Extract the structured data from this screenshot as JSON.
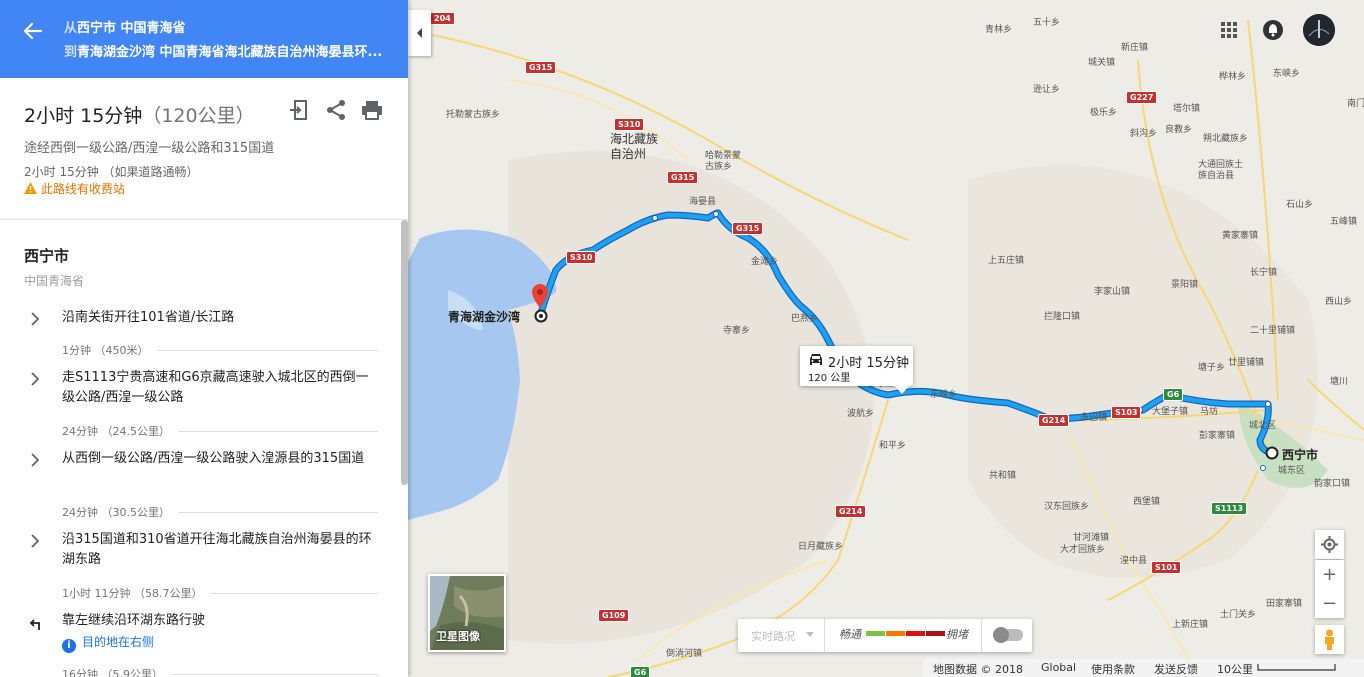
{
  "header": {
    "from_prefix": "从",
    "from_place": "西宁市 中国青海省",
    "to_prefix": "到",
    "to_place": "青海湖金沙湾 中国青海省海北藏族自治州海晏县环..."
  },
  "summary": {
    "time": "2小时 15分钟",
    "distance": "（120公里）",
    "via": "途经西倒一级公路/西湟一级公路和315国道",
    "traffic": "2小时 15分钟 （如果道路通畅）",
    "toll": "此路线有收费站"
  },
  "origin": {
    "title": "西宁市",
    "subtitle": "中国青海省"
  },
  "steps": [
    {
      "text": "沿南关街开往101省道/长江路",
      "dist": "1分钟 （450米）"
    },
    {
      "text": "走S1113宁贵高速和G6京藏高速驶入城北区的西倒一级公路/西湟一级公路",
      "dist": "24分钟 （24.5公里）"
    },
    {
      "text": "从西倒一级公路/西湟一级公路驶入湟源县的315国道",
      "dist": "24分钟 （30.5公里）"
    },
    {
      "text": "沿315国道和310省道开往海北藏族自治州海晏县的环湖东路",
      "dist": "1小时 11分钟 （58.7公里）"
    },
    {
      "text": "靠左继续沿环湖东路行驶",
      "note": "目的地在右侧",
      "dist": "16分钟 （5.9公里）"
    }
  ],
  "map": {
    "route_box": {
      "time": "2小时 15分钟",
      "distance": "120 公里"
    },
    "dest_label": "青海湖金沙湾",
    "origin_label": "西宁市",
    "satellite_label": "卫星图像",
    "traffic": {
      "live": "实时路况",
      "fast": "畅通",
      "slow": "拥堵",
      "colors": [
        "#7fc241",
        "#f57c00",
        "#e01010",
        "#a31515"
      ]
    },
    "footer": {
      "data": "地图数据 © 2018",
      "global": "Global",
      "terms": "使用条款",
      "feedback": "发送反馈",
      "scale": "10公里"
    },
    "route_color": "#1da1f2",
    "labels": [
      {
        "t": "青林乡"
      },
      {
        "t": "五十乡"
      },
      {
        "t": "城关镇"
      },
      {
        "t": "新庄镇"
      },
      {
        "t": "东峡乡"
      },
      {
        "t": "朔北藏族乡"
      },
      {
        "t": "大通回族土族自治县"
      },
      {
        "t": "良教乡"
      },
      {
        "t": "斜沟乡"
      },
      {
        "t": "极乐乡"
      },
      {
        "t": "逊让乡"
      },
      {
        "t": "塔尔镇"
      },
      {
        "t": "托勒蒙古族乡"
      },
      {
        "t": "哈勒景蒙古族乡"
      },
      {
        "t": "海晏县"
      },
      {
        "t": "海北藏族自治州"
      },
      {
        "t": "金滩乡"
      },
      {
        "t": "巴燕乡"
      },
      {
        "t": "寺寨乡"
      },
      {
        "t": "日月山"
      },
      {
        "t": "东峡乡"
      },
      {
        "t": "波航乡"
      },
      {
        "t": "和平乡"
      },
      {
        "t": "日月藏族乡"
      },
      {
        "t": "倒淌河镇"
      },
      {
        "t": "共和镇"
      },
      {
        "t": "汉东回族乡"
      },
      {
        "t": "甘河滩镇"
      },
      {
        "t": "大才回族乡"
      },
      {
        "t": "湟中县"
      },
      {
        "t": "多巴镇"
      },
      {
        "t": "大堡子镇"
      },
      {
        "t": "马坊"
      },
      {
        "t": "彭家寨镇"
      },
      {
        "t": "城北区"
      },
      {
        "t": "城东区"
      },
      {
        "t": "韵家口镇"
      },
      {
        "t": "西堡镇"
      },
      {
        "t": "上五庄镇"
      },
      {
        "t": "李家山镇"
      },
      {
        "t": "拦隆口镇"
      },
      {
        "t": "景阳镇"
      },
      {
        "t": "长宁镇"
      },
      {
        "t": "二十里铺镇"
      },
      {
        "t": "廿里铺镇"
      },
      {
        "t": "塘子乡"
      },
      {
        "t": "黄家寨镇"
      },
      {
        "t": "石山乡"
      },
      {
        "t": "五峰镇"
      },
      {
        "t": "西山乡"
      },
      {
        "t": "塘川"
      },
      {
        "t": "南门"
      },
      {
        "t": "桦林乡"
      },
      {
        "t": "上新庄镇"
      },
      {
        "t": "田家寨镇"
      },
      {
        "t": "土门关乡"
      }
    ],
    "shields": [
      {
        "t": "G315"
      },
      {
        "t": "S310"
      },
      {
        "t": "G315"
      },
      {
        "t": "S310"
      },
      {
        "t": "G315"
      },
      {
        "t": "G227"
      },
      {
        "t": "G214"
      },
      {
        "t": "S103"
      },
      {
        "t": "G6"
      },
      {
        "t": "S1113"
      },
      {
        "t": "G214"
      },
      {
        "t": "S101"
      },
      {
        "t": "G109"
      },
      {
        "t": "G6"
      },
      {
        "t": "204"
      }
    ]
  }
}
